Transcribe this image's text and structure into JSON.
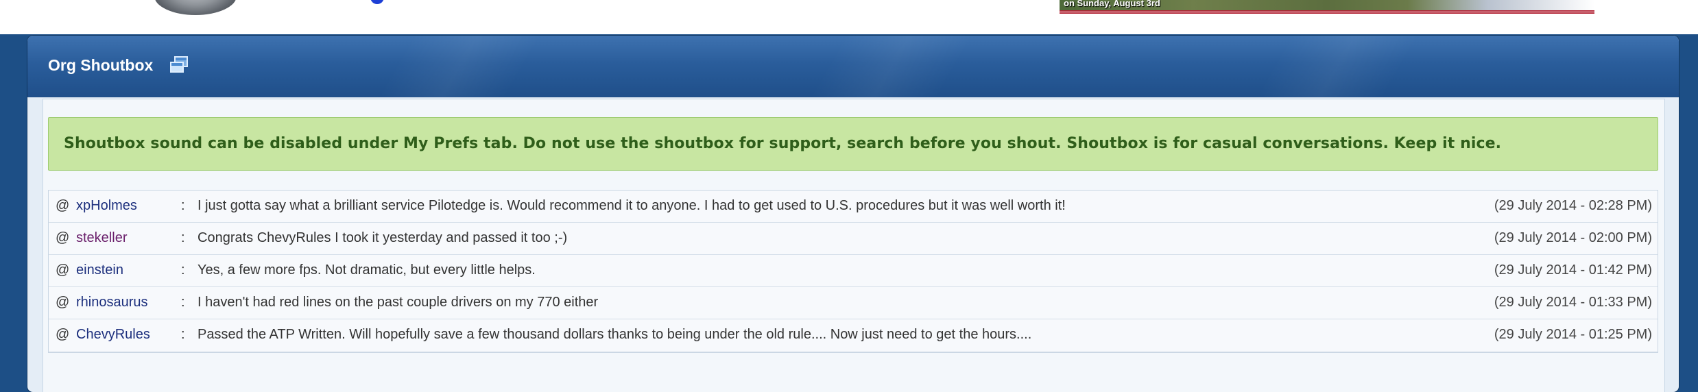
{
  "top_banner": {
    "text": "on Sunday, August 3rd"
  },
  "panel": {
    "title": "Org Shoutbox",
    "icon": "window-icon"
  },
  "notice": {
    "text": "Shoutbox sound can be disabled under My Prefs tab. Do not use the shoutbox for support, search before you shout. Shoutbox is for casual conversations. Keep it nice."
  },
  "shouts": [
    {
      "at": "@",
      "user": "xpHolmes",
      "sep": ":",
      "message": "I just gotta say what a brilliant service Pilotedge is. Would recommend it to anyone. I had to get used to U.S. procedures but it was well worth it!",
      "time": "(29 July 2014 - 02:28 PM)"
    },
    {
      "at": "@",
      "user": "stekeller",
      "sep": ":",
      "message": "Congrats ChevyRules I took it yesterday and passed it too ;-)",
      "time": "(29 July 2014 - 02:00 PM)"
    },
    {
      "at": "@",
      "user": "einstein",
      "sep": ":",
      "message": "Yes, a few more fps. Not dramatic, but every little helps.",
      "time": "(29 July 2014 - 01:42 PM)"
    },
    {
      "at": "@",
      "user": "rhinosaurus",
      "sep": ":",
      "message": "I haven't had red lines on the past couple drivers on my 770 either",
      "time": "(29 July 2014 - 01:33 PM)"
    },
    {
      "at": "@",
      "user": "ChevyRules",
      "sep": ":",
      "message": "Passed the ATP Written. Will hopefully save a few thousand dollars thanks to being under the old rule.... Now just need to get the hours....",
      "time": "(29 July 2014 - 01:25 PM)"
    }
  ],
  "colors": {
    "header": "#2a5d9b",
    "notice_bg": "#c8e6a2",
    "notice_text": "#2f5e1a",
    "username": "#1c2f7d",
    "username_alt": "#6a1f6b"
  }
}
